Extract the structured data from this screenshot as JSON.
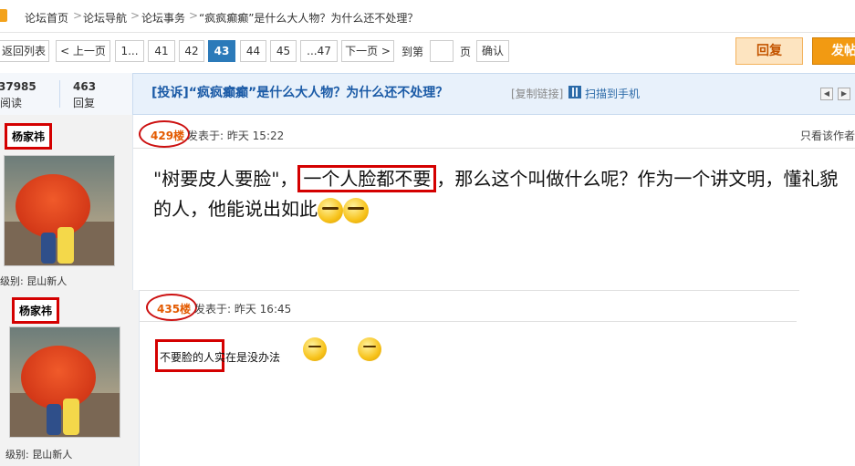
{
  "breadcrumb": {
    "items": [
      "论坛首页",
      "论坛导航",
      "论坛事务",
      "“疯疯癫癫”是什么大人物？为什么还不处理？"
    ],
    "sep": ">"
  },
  "pager": {
    "back_to_list": "返回列表",
    "prev": "< 上一页",
    "first": "1...",
    "pages": [
      "41",
      "42",
      "43",
      "44",
      "45"
    ],
    "current": "43",
    "last": "...47",
    "next": "下一页 >",
    "goto_label": "到第",
    "goto_value": "",
    "page_unit": "页",
    "confirm": "确认"
  },
  "actions": {
    "reply": "回复",
    "post": "发帖"
  },
  "stats": {
    "views_num": "37985",
    "views_label": "阅读",
    "replies_num": "463",
    "replies_label": "回复"
  },
  "thread": {
    "title": "[投诉]“疯疯癫癫”是什么大人物？为什么还不处理？",
    "copy_link": "[复制链接]",
    "scan_mobile": "扫描到手机"
  },
  "posts": [
    {
      "author": "杨家祎",
      "level": "级别: 昆山新人",
      "floor": "429楼",
      "time": "发表于: 昨天 15:22",
      "only_author": "只看该作者",
      "body_part1": "\"树要皮人要脸\"，",
      "body_highlight": "一个人脸都不要",
      "body_part2": "，那么这个叫做什么呢？作为一个讲文明，懂礼貌的人，他能说出如此"
    },
    {
      "author": "杨家祎",
      "level": "级别: 昆山新人",
      "floor": "435楼",
      "time": "发表于: 昨天 16:45",
      "body_highlight": "不要脸的人",
      "body_rest": "实在是没办法"
    }
  ],
  "icons": {
    "home": "home-icon",
    "qr": "qr-code-icon",
    "emoji": "grimace-emoji-icon",
    "smile": "smile-emoji-icon"
  },
  "colors": {
    "accent_blue": "#2b7ab9",
    "highlight_red": "#d40000",
    "floor_orange": "#e35a00",
    "post_btn": "#f29a12"
  }
}
